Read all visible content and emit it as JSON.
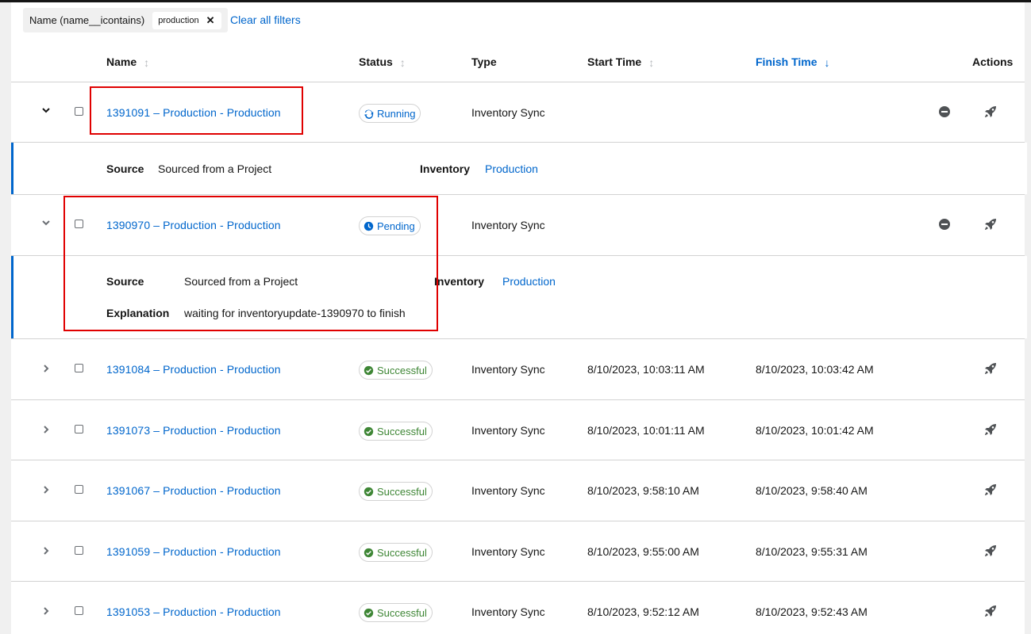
{
  "filters": {
    "category": "Name (name__icontains)",
    "chip_value": "production",
    "chip_close": "✕",
    "clear_label": "Clear all filters"
  },
  "table": {
    "headers": {
      "name": "Name",
      "status": "Status",
      "type": "Type",
      "start_time": "Start Time",
      "finish_time": "Finish Time",
      "actions": "Actions"
    },
    "rows": [
      {
        "name": "1391091 – Production - Production",
        "status": "Running",
        "type": "Inventory Sync",
        "start": "",
        "finish": ""
      },
      {
        "name": "1390970 – Production - Production",
        "status": "Pending",
        "type": "Inventory Sync",
        "start": "",
        "finish": ""
      },
      {
        "name": "1391084 – Production - Production",
        "status": "Successful",
        "type": "Inventory Sync",
        "start": "8/10/2023, 10:03:11 AM",
        "finish": "8/10/2023, 10:03:42 AM"
      },
      {
        "name": "1391073 – Production - Production",
        "status": "Successful",
        "type": "Inventory Sync",
        "start": "8/10/2023, 10:01:11 AM",
        "finish": "8/10/2023, 10:01:42 AM"
      },
      {
        "name": "1391067 – Production - Production",
        "status": "Successful",
        "type": "Inventory Sync",
        "start": "8/10/2023, 9:58:10 AM",
        "finish": "8/10/2023, 9:58:40 AM"
      },
      {
        "name": "1391059 – Production - Production",
        "status": "Successful",
        "type": "Inventory Sync",
        "start": "8/10/2023, 9:55:00 AM",
        "finish": "8/10/2023, 9:55:31 AM"
      },
      {
        "name": "1391053 – Production - Production",
        "status": "Successful",
        "type": "Inventory Sync",
        "start": "8/10/2023, 9:52:12 AM",
        "finish": "8/10/2023, 9:52:43 AM"
      }
    ],
    "expanded": [
      {
        "source_label": "Source",
        "source": "Sourced from a Project",
        "inventory_label": "Inventory",
        "inventory": "Production"
      },
      {
        "source_label": "Source",
        "source": "Sourced from a Project",
        "inventory_label": "Inventory",
        "inventory": "Production",
        "explanation_label": "Explanation",
        "explanation": "waiting for inventoryupdate-1390970 to finish"
      }
    ]
  },
  "colors": {
    "link": "#0066cc",
    "success": "#3e8635",
    "annotation": "#e00000",
    "expand_border": "#0066cc"
  },
  "icons": {
    "expanded_toggle": "chevron-down-icon",
    "collapsed_toggle": "chevron-right-icon",
    "cancel": "minus-circle-icon",
    "launch": "rocket-icon",
    "running": "sync-icon",
    "pending": "clock-icon",
    "successful": "check-circle-icon"
  }
}
